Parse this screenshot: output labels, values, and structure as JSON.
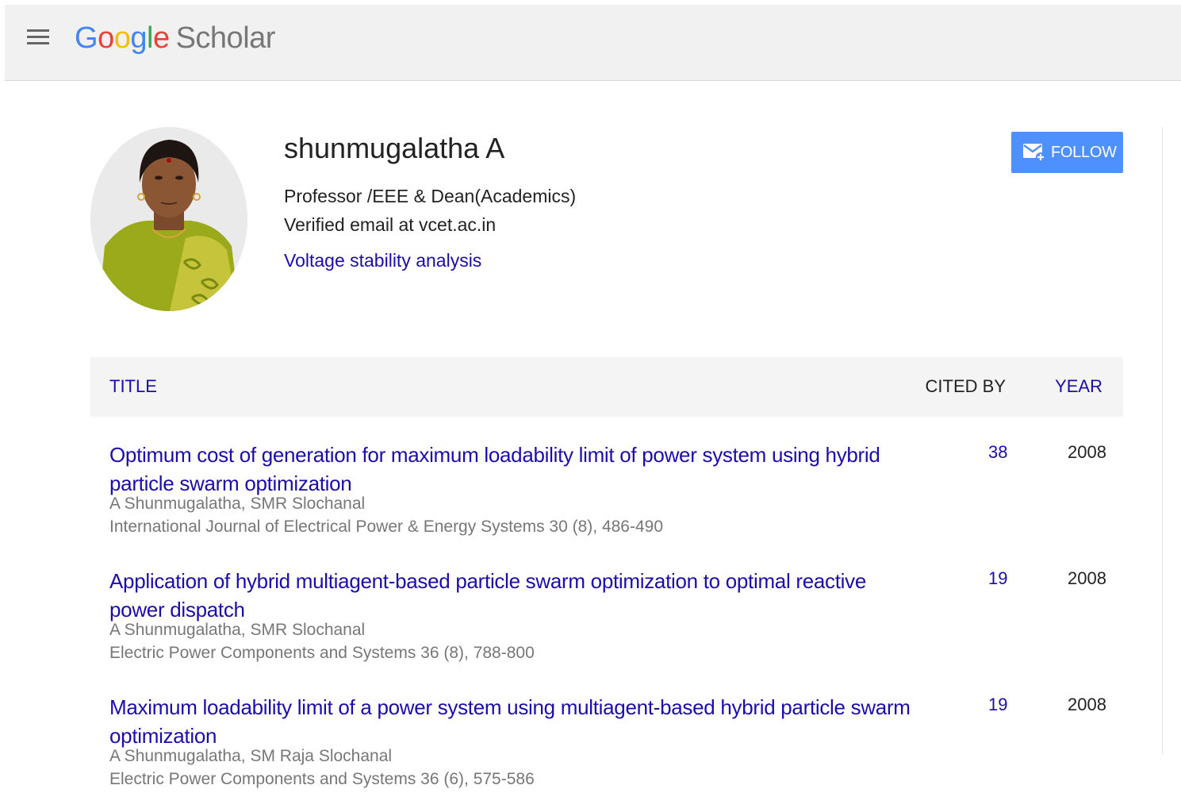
{
  "header": {
    "logo": {
      "letters": [
        {
          "ch": "G",
          "color": "#4285F4"
        },
        {
          "ch": "o",
          "color": "#EA4335"
        },
        {
          "ch": "o",
          "color": "#FBBC05"
        },
        {
          "ch": "g",
          "color": "#4285F4"
        },
        {
          "ch": "l",
          "color": "#34A853"
        },
        {
          "ch": "e",
          "color": "#EA4335"
        }
      ],
      "word2": "Scholar"
    }
  },
  "profile": {
    "name": "shunmugalatha A",
    "affiliation": "Professor /EEE & Dean(Academics)",
    "email": "Verified email at vcet.ac.in",
    "interest": "Voltage stability analysis",
    "follow_label": "FOLLOW"
  },
  "table": {
    "headers": {
      "title": "TITLE",
      "cited_by": "CITED BY",
      "year": "YEAR"
    },
    "rows": [
      {
        "title": "Optimum cost of generation for maximum loadability limit of power system using hybrid particle swarm optimization",
        "authors": "A Shunmugalatha, SMR Slochanal",
        "venue": "International Journal of Electrical Power & Energy Systems 30 (8), 486-490",
        "cited_by": "38",
        "year": "2008"
      },
      {
        "title": "Application of hybrid multiagent-based particle swarm optimization to optimal reactive power dispatch",
        "authors": "A Shunmugalatha, SMR Slochanal",
        "venue": "Electric Power Components and Systems 36 (8), 788-800",
        "cited_by": "19",
        "year": "2008"
      },
      {
        "title": "Maximum loadability limit of a power system using multiagent-based hybrid particle swarm optimization",
        "authors": "A Shunmugalatha, SM Raja Slochanal",
        "venue": "Electric Power Components and Systems 36 (6), 575-586",
        "cited_by": "19",
        "year": "2008"
      }
    ]
  },
  "colors": {
    "link": "#1a0dab",
    "follow_bg": "#4d90fe",
    "header_bg": "#f1f1f1"
  },
  "icons": {
    "menu": "hamburger-menu-icon",
    "follow": "mail-plus-icon"
  }
}
